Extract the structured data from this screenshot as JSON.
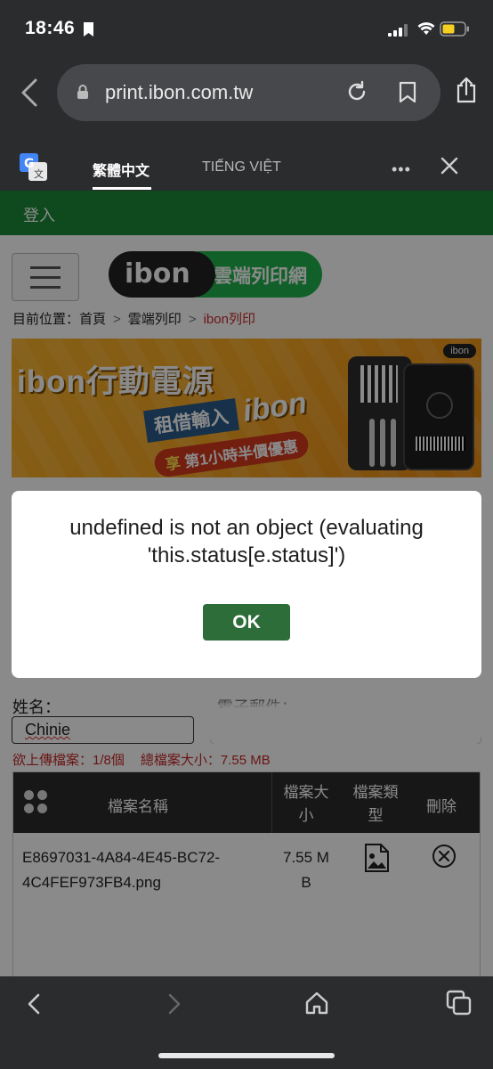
{
  "status_bar": {
    "time": "18:46",
    "icons": [
      "bookmark-icon",
      "signal-icon",
      "wifi-icon",
      "battery-icon"
    ]
  },
  "browser": {
    "url": "print.ibon.com.tw",
    "icons": [
      "back-icon",
      "lock-icon",
      "reload-icon",
      "bookmark-icon",
      "share-icon"
    ]
  },
  "translate": {
    "tabs": [
      {
        "label": "繁體中文",
        "selected": true
      },
      {
        "label": "TIẾNG VIỆT",
        "selected": false
      }
    ],
    "more": "•••"
  },
  "page": {
    "login": "登入",
    "logo_left": "ibon",
    "logo_right": "雲端列印網",
    "breadcrumb": {
      "prefix": "目前位置：",
      "items": [
        "首頁",
        "雲端列印",
        "ibon列印"
      ],
      "separator": ">"
    },
    "banner": {
      "title": "ibon行動電源",
      "sub": "租借輸入",
      "sub2": "ibon",
      "promo_prefix": "享",
      "promo_text": "第1小時半價優惠"
    },
    "form": {
      "name_label": "姓名：",
      "name_value": "Chinie",
      "email_label": "電子郵件：",
      "upload_count": "欲上傳檔案：1/8個",
      "total_size": "總檔案大小：7.55 MB"
    },
    "table": {
      "headers": {
        "name": "檔案名稱",
        "size_l1": "檔案大",
        "size_l2": "小",
        "type_l1": "檔案類",
        "type_l2": "型",
        "delete": "刪除"
      },
      "rows": [
        {
          "name_l1": "E8697031-4A84-4E45-BC72-",
          "name_l2": "4C4FEF973FB4.png",
          "size_l1": "7.55 M",
          "size_l2": "B",
          "type_icon": "image-file-icon",
          "delete_icon": "remove-circle-icon"
        }
      ]
    }
  },
  "dialog": {
    "message_l1": "undefined is not an object (evaluating",
    "message_l2": "'this.status[e.status]')",
    "ok": "OK"
  },
  "toolbar": {
    "icons": [
      "back-icon",
      "forward-icon",
      "home-icon",
      "tabs-icon"
    ]
  },
  "colors": {
    "chrome": "#2b2c2e",
    "ibon_green": "#1c8a3a",
    "ok_button": "#2d6d3a",
    "error_red": "#c62828"
  }
}
